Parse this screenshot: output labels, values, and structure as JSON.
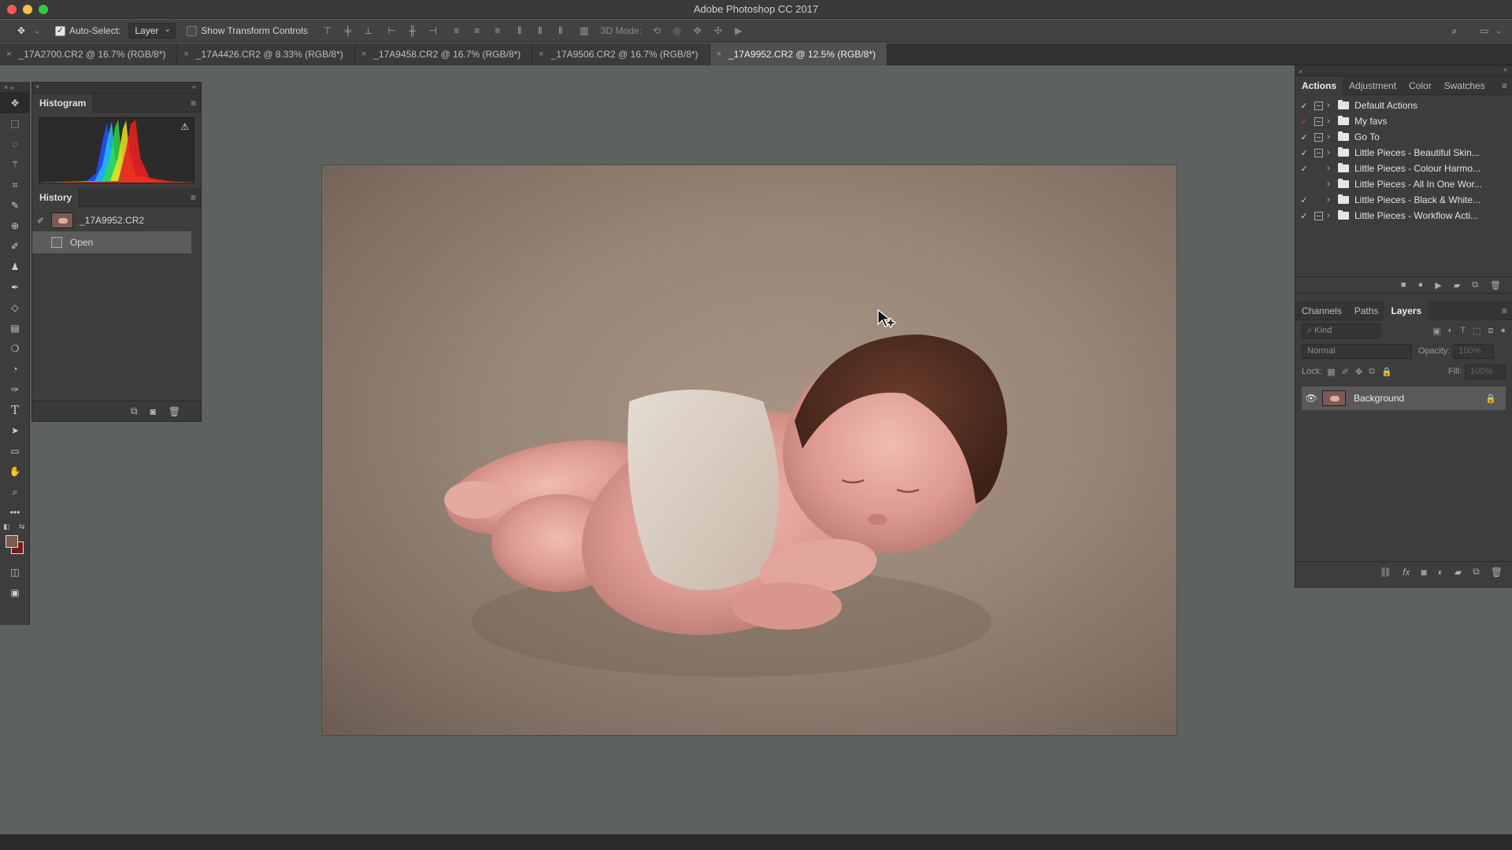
{
  "window": {
    "title": "Adobe Photoshop CC 2017"
  },
  "options_bar": {
    "auto_select_label": "Auto-Select:",
    "auto_select_checked": true,
    "auto_select_target": "Layer",
    "show_transform_label": "Show Transform Controls",
    "show_transform_checked": false,
    "three_d_mode_label": "3D Mode:"
  },
  "document_tabs": [
    {
      "label": "_17A2700.CR2 @ 16.7% (RGB/8*)",
      "active": false
    },
    {
      "label": "_17A4426.CR2 @ 8.33% (RGB/8*)",
      "active": false
    },
    {
      "label": "_17A9458.CR2 @ 16.7% (RGB/8*)",
      "active": false
    },
    {
      "label": "_17A9506.CR2 @ 16.7% (RGB/8*)",
      "active": false
    },
    {
      "label": "_17A9952.CR2 @ 12.5% (RGB/8*)",
      "active": true
    }
  ],
  "histogram_panel": {
    "title": "Histogram",
    "warning_icon": "warning-icon"
  },
  "history_panel": {
    "title": "History",
    "snapshot": "_17A9952.CR2",
    "states": [
      "Open"
    ]
  },
  "actions_panel": {
    "tabs": [
      "Actions",
      "Adjustment",
      "Color",
      "Swatches"
    ],
    "active_tab": "Actions",
    "items": [
      {
        "label": "Default Actions",
        "checked": true,
        "dialog": true
      },
      {
        "label": "My favs",
        "checked": true,
        "dialog": true,
        "check_color": "#d04040"
      },
      {
        "label": "Go To",
        "checked": true,
        "dialog": true
      },
      {
        "label": "Little Pieces - Beautiful Skin...",
        "checked": true,
        "dialog": true
      },
      {
        "label": "Little Pieces - Colour Harmo...",
        "checked": true,
        "dialog": false
      },
      {
        "label": "Little Pieces - All In One Wor...",
        "checked": false,
        "dialog": false
      },
      {
        "label": "Little Pieces - Black & White...",
        "checked": true,
        "dialog": false
      },
      {
        "label": "Little Pieces - Workflow Acti...",
        "checked": true,
        "dialog": true
      }
    ]
  },
  "layers_panel": {
    "tabs": [
      "Channels",
      "Paths",
      "Layers"
    ],
    "active_tab": "Layers",
    "filter_placeholder": "Kind",
    "blend_mode": "Normal",
    "opacity_label": "Opacity:",
    "opacity_value": "100%",
    "lock_label": "Lock:",
    "fill_label": "Fill:",
    "fill_value": "100%",
    "layers": [
      {
        "name": "Background",
        "visible": true,
        "locked": true
      }
    ]
  },
  "colors": {
    "foreground": "#7b5b4a",
    "background": "#7c1a1a"
  }
}
